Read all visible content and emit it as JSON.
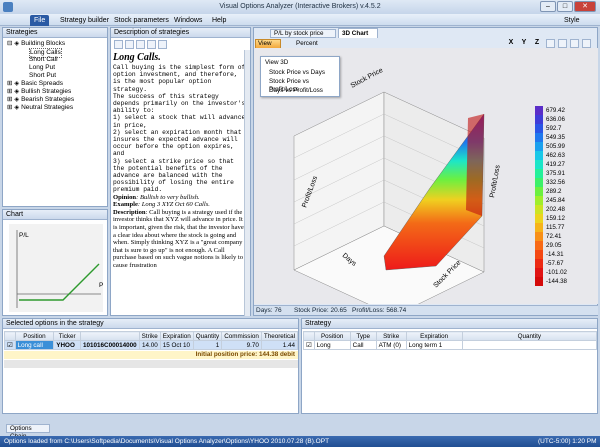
{
  "titlebar": {
    "title": "Visual Options Analyzer (Interactive Brokers) v.4.5.2",
    "minimize": "–",
    "maximize": "□",
    "close": "✕"
  },
  "menubar": {
    "items": [
      "File",
      "Strategy builder",
      "Stock parameters",
      "Windows",
      "Help"
    ],
    "active": "File",
    "style_label": "Style"
  },
  "strategies": {
    "header": "Strategies",
    "tree": [
      {
        "label": "Building Blocks"
      },
      {
        "label": "Long Calls"
      },
      {
        "label": "Short Call"
      },
      {
        "label": "Long Put"
      },
      {
        "label": "Short Put"
      },
      {
        "label": "Basic Spreads"
      },
      {
        "label": "Bullish Strategies"
      },
      {
        "label": "Bearish Strategies"
      },
      {
        "label": "Neutral Strategies"
      }
    ]
  },
  "chart_small": {
    "header": "Chart",
    "y_label": "P/L",
    "x_label": "P"
  },
  "description": {
    "header": "Description of strategies",
    "title": "Long Calls.",
    "mono_text": "Call buying is the simplest form of option investment, and therefore, is the most popular option strategy.\nThe success of this strategy depends primarily on the investor's ability to:\n1) select a stock that will advance in price,\n2) select an expiration month that insures the expected advance will occur before the option expires, and\n3) select a strike price so that the potential benefits of the advance are balanced with the possibility of losing the entire premium paid.",
    "opinion_label": "Opinion",
    "opinion": ": Bullish to very bullish.",
    "example_label": "Example",
    "example": ": Long 3 XYZ Oct 60 Calls.",
    "desc_label": "Description",
    "desc": ": Call buying is a strategy used if the investor thinks that XYZ will advance in price. It is important, given the risk, that the investor have a clear idea about where the stock is going and when. Simply thinking XYZ is a \"great company that is sure to go up\" is not enough. A Call purchase based on such vague notions is likely to cause frustration"
  },
  "chart_tabs": {
    "tab1": "P/L by stock price",
    "tab2": "3D Chart",
    "view_btn": "View 3D",
    "percent": "Percent"
  },
  "view_menu": {
    "items": [
      "View 3D",
      "Stock Price vs Days",
      "Stock Price vs Profit/Loss",
      "Days vs Profit/Loss"
    ]
  },
  "toolbar_right": {
    "x": "X",
    "y": "Y",
    "z": "Z"
  },
  "chart3d": {
    "axis_labels": {
      "stock_price_top": "Stock Price",
      "profitloss_left": "Profit/Loss",
      "days": "Days",
      "stock_price_bottom": "Stock Price",
      "profitloss_right": "Profit/Loss"
    },
    "legend": [
      "679.42",
      "636.06",
      "592.7",
      "549.35",
      "505.99",
      "462.63",
      "419.27",
      "375.91",
      "332.56",
      "289.2",
      "245.84",
      "202.48",
      "159.12",
      "115.77",
      "72.41",
      "29.05",
      "-14.31",
      "-57.67",
      "-101.02",
      "-144.38"
    ],
    "legend_colors": [
      "#5a2dc8",
      "#3f3cd8",
      "#2a55e6",
      "#1f78ee",
      "#1aa0ee",
      "#19c8e8",
      "#1ce6c8",
      "#24f09a",
      "#3cf06a",
      "#6cf040",
      "#a0ee2c",
      "#cce424",
      "#ecd41e",
      "#f6b41a",
      "#f89018",
      "#f86a16",
      "#f44814",
      "#ec2a14",
      "#e01414",
      "#d40a0a"
    ]
  },
  "statusbar_chart": {
    "days": "Days: 76",
    "stock_price": "Stock Price: 20.65",
    "profit_loss": "Profit/Loss: 568.74"
  },
  "selected_options": {
    "header": "Selected options in the strategy",
    "columns": [
      "",
      "Position",
      "Ticker",
      "",
      "Strike",
      "Expiration",
      "Quantity",
      "Commission",
      "Theoretical"
    ],
    "row": {
      "position": "Long call",
      "ticker": "YHOO",
      "contract": "101016C00014000",
      "strike": "14.00",
      "expiration": "15 Oct 10",
      "quantity": "1",
      "commission": "9.70",
      "theoretical": "1.44"
    },
    "initial": "Initial position price: 144.38 debit"
  },
  "strategy": {
    "header": "Strategy",
    "columns": [
      "",
      "Position",
      "Type",
      "Strike",
      "Expiration",
      "Quantity"
    ],
    "row": {
      "position": "Long",
      "type": "Call",
      "strike": "ATM (0)",
      "expiration": "Long term 1",
      "quantity": ""
    }
  },
  "bottom_tab": "Options Chain",
  "statusbar": {
    "left": "Options loaded from C:\\Users\\Softpedia\\Documents\\Visual Options Analyzer\\Options\\YHOO 2010.07.28 (B).OPT",
    "right": "(UTC-5:00) 1:20 PM"
  }
}
